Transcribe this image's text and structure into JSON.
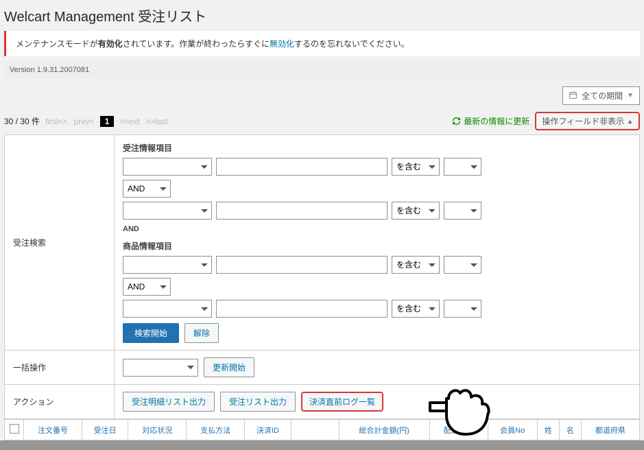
{
  "header": {
    "title": "Welcart Management 受注リスト"
  },
  "notice": {
    "pre": "メンテナンスモードが",
    "bold": "有効化",
    "mid": "されています。作業が終わったらすぐに",
    "link": "無効化",
    "post": "するのを忘れないでください。"
  },
  "version": "Version 1.9.31.2007081",
  "period": {
    "label": "全ての期間"
  },
  "pager": {
    "count": "30 / 30 件",
    "first": "first<<",
    "prev": "prev<",
    "current": "1",
    "next": ">next",
    "last": ">>last"
  },
  "topright": {
    "refresh": "最新の情報に更新",
    "toggle_fields": "操作フィールド非表示"
  },
  "search": {
    "row_label": "受注検索",
    "order_section": "受注情報項目",
    "product_section": "商品情報項目",
    "and_label": "AND",
    "and_opt": "AND",
    "contains": "を含む",
    "btn_start": "検索開始",
    "btn_clear": "解除"
  },
  "bulk": {
    "row_label": "一括操作",
    "btn_update": "更新開始"
  },
  "actions": {
    "row_label": "アクション",
    "btn_detail": "受注明細リスト出力",
    "btn_list": "受注リスト出力",
    "btn_log": "決済直前ログ一覧"
  },
  "columns": [
    "注文番号",
    "受注日",
    "対応状況",
    "支払方法",
    "決済ID",
    "",
    "総合計金額(円)",
    "配送方法",
    "会員No",
    "姓",
    "名",
    "都道府県"
  ]
}
